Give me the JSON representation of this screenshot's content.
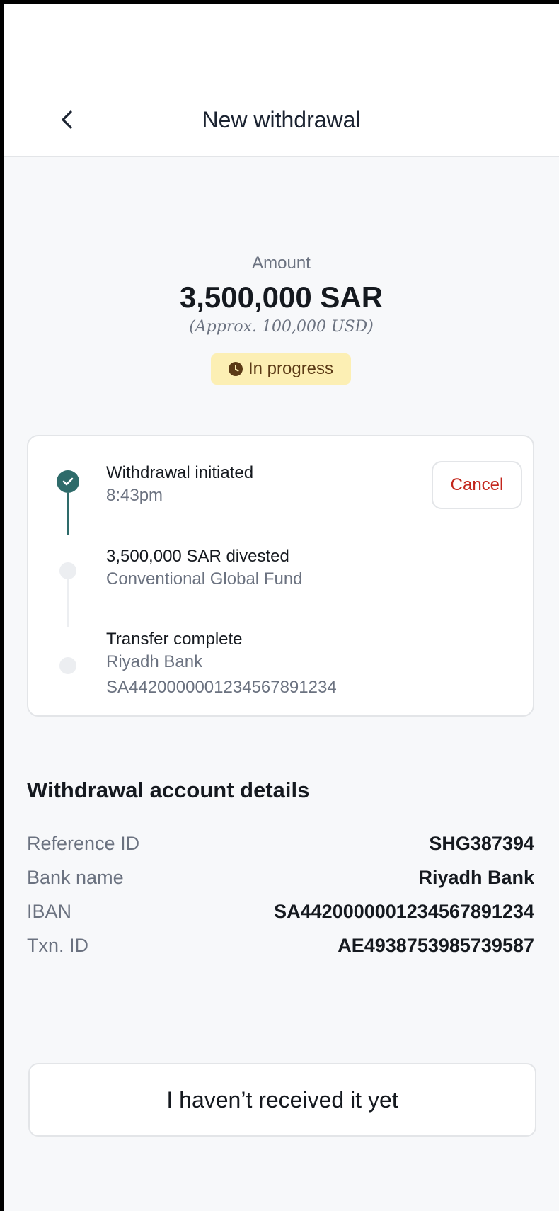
{
  "header": {
    "title": "New withdrawal",
    "back_icon": "chevron-left-icon"
  },
  "amount": {
    "label": "Amount",
    "value": "3,500,000 SAR",
    "approx": "(Approx. 100,000 USD)"
  },
  "status": {
    "label": "In progress",
    "icon": "clock-icon",
    "color": "#fcefb4"
  },
  "timeline": {
    "cancel_label": "Cancel",
    "steps": [
      {
        "title": "Withdrawal initiated",
        "sub": "8:43pm",
        "state": "done"
      },
      {
        "title": "3,500,000 SAR divested",
        "sub": "Conventional Global Fund",
        "state": "pending"
      },
      {
        "title": "Transfer complete",
        "sub": "Riyadh Bank",
        "sub2": "SA4420000001234567891234",
        "state": "pending"
      }
    ]
  },
  "details": {
    "title": "Withdrawal account details",
    "rows": [
      {
        "label": "Reference ID",
        "value": "SHG387394"
      },
      {
        "label": "Bank name",
        "value": "Riyadh Bank"
      },
      {
        "label": "IBAN",
        "value": "SA4420000001234567891234"
      },
      {
        "label": "Txn. ID",
        "value": "AE4938753985739587"
      }
    ]
  },
  "footer": {
    "button_label": "I haven’t received it yet"
  },
  "colors": {
    "accent": "#2e6b6a",
    "danger": "#c3261c",
    "badge_text": "#5b3a16"
  }
}
